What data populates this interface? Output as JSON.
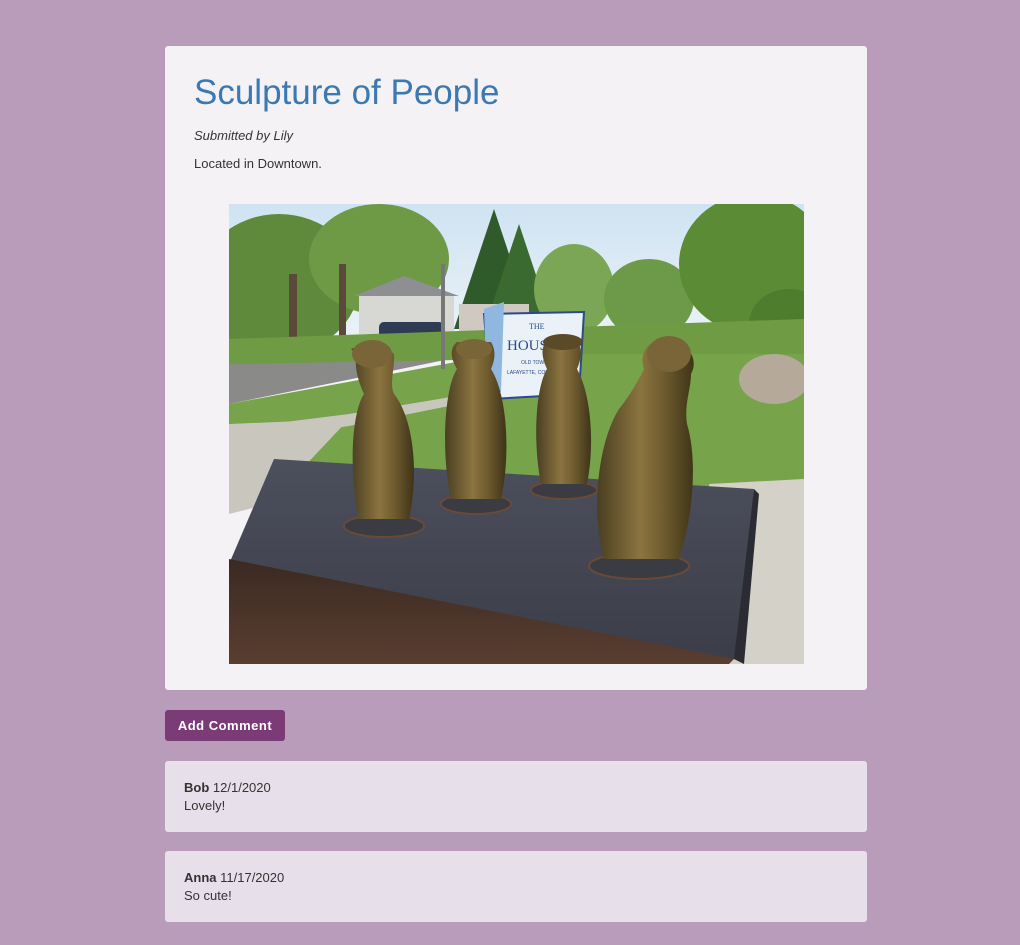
{
  "post": {
    "title": "Sculpture of People",
    "submitted_by": "Submitted by Lily",
    "location": "Located in Downtown.",
    "image_alt": "Sculpture of People",
    "sign_text": {
      "line1": "THE",
      "line2": "HOUSE IN",
      "line3": "OLD TOWN",
      "line4": "LAFAYETTE, COLORADO"
    }
  },
  "actions": {
    "add_comment_label": "Add Comment"
  },
  "comments": [
    {
      "author": "Bob",
      "date": "12/1/2020",
      "text": "Lovely!"
    },
    {
      "author": "Anna",
      "date": "11/17/2020",
      "text": "So cute!"
    }
  ],
  "colors": {
    "page_background": "#b99cba",
    "card_background": "#f5f2f6",
    "title": "#3a79b1",
    "button": "#7a3b77",
    "comment_background": "#e7dfe9"
  }
}
